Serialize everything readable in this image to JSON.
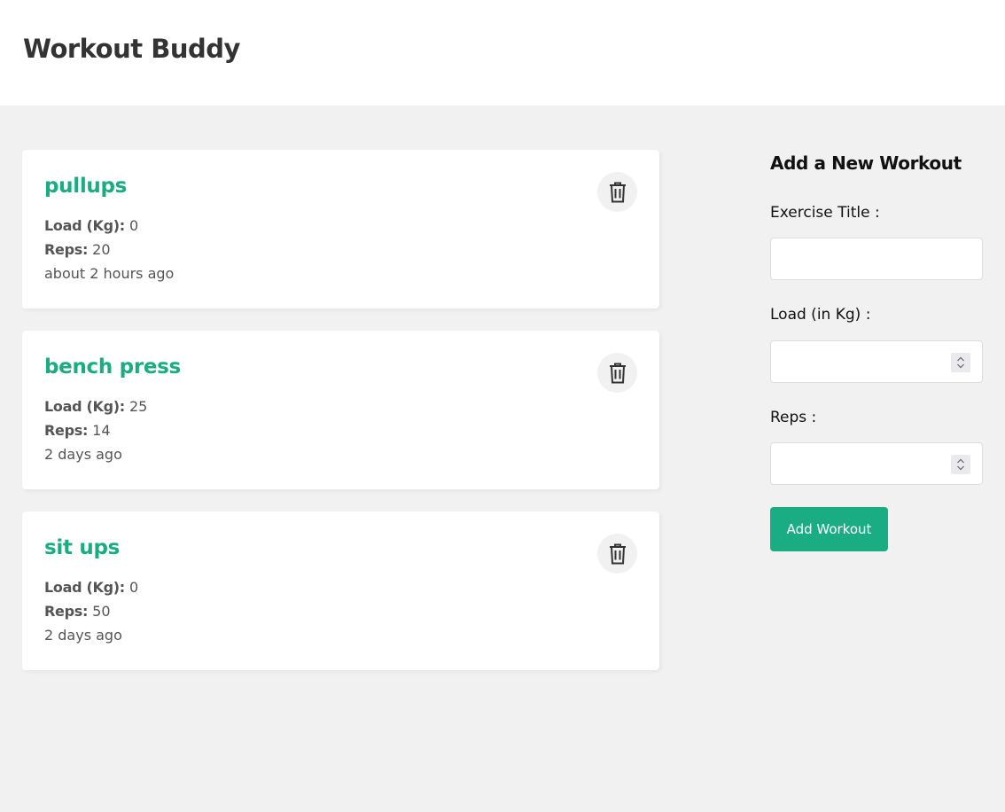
{
  "header": {
    "title": "Workout Buddy"
  },
  "workouts": [
    {
      "title": "pullups",
      "load_label": "Load (Kg):",
      "load": "0",
      "reps_label": "Reps:",
      "reps": "20",
      "time": "about 2 hours ago",
      "delete_icon": "trash-icon"
    },
    {
      "title": "bench press",
      "load_label": "Load (Kg):",
      "load": "25",
      "reps_label": "Reps:",
      "reps": "14",
      "time": "2 days ago",
      "delete_icon": "trash-icon"
    },
    {
      "title": "sit ups",
      "load_label": "Load (Kg):",
      "load": "0",
      "reps_label": "Reps:",
      "reps": "50",
      "time": "2 days ago",
      "delete_icon": "trash-icon"
    }
  ],
  "form": {
    "heading": "Add a New Workout",
    "title_label": "Exercise Title :",
    "title_value": "",
    "load_label": "Load (in Kg) :",
    "load_value": "",
    "reps_label": "Reps :",
    "reps_value": "",
    "submit_label": "Add Workout"
  },
  "colors": {
    "accent": "#1aac83",
    "background": "#f1f1f1",
    "card": "#ffffff",
    "text": "#333333"
  }
}
